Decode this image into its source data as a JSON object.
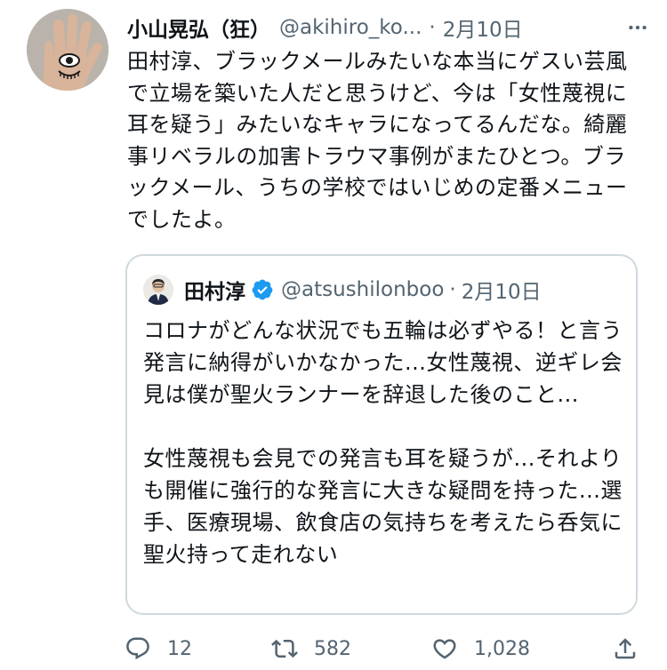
{
  "tweet": {
    "author_name": "小山晃弘（狂）",
    "author_handle": "@akihiro_ko...",
    "separator": "·",
    "date": "2月10日",
    "text": "田村淳、ブラックメールみたいな本当にゲスい芸風で立場を築いた人だと思うけど、今は「女性蔑視に耳を疑う」みたいなキャラになってるんだな。綺麗事リベラルの加害トラウマ事例がまたひとつ。ブラックメール、うちの学校ではいじめの定番メニューでしたよ。",
    "avatar_icon": "hand-eye-avatar"
  },
  "quote": {
    "author_name": "田村淳",
    "author_handle": "@atsushilonboo",
    "separator": "·",
    "date": "2月10日",
    "verified_icon": "verified-badge-icon",
    "text": "コロナがどんな状況でも五輪は必ずやる！と言う発言に納得がいかなかった...女性蔑視、逆ギレ会見は僕が聖火ランナーを辞退した後のこと...\n\n女性蔑視も会見での発言も耳を疑うが...それよりも開催に強行的な発言に大きな疑問を持った...選手、医療現場、飲食店の気持ちを考えたら呑気に聖火持って走れない"
  },
  "actions": {
    "reply_count": "12",
    "retweet_count": "582",
    "like_count": "1,028"
  },
  "colors": {
    "text": "#0f1419",
    "secondary": "#536471",
    "verified": "#1d9bf0",
    "border": "#cfd9de"
  }
}
